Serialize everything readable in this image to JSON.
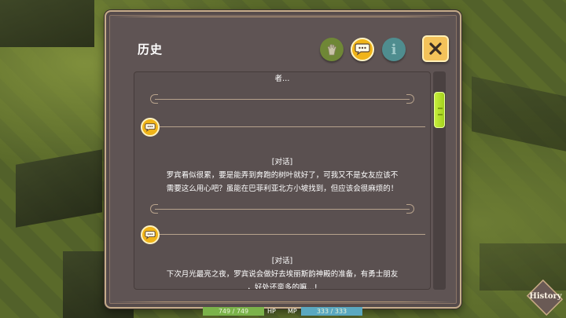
{
  "panel": {
    "title": "历史"
  },
  "header_buttons": {
    "hand_icon": "hand-icon",
    "chat_icon": "speech-bubble-icon",
    "info_label": "i",
    "close_icon": "close-icon"
  },
  "log": {
    "entries": [
      {
        "tag": "",
        "lines": [
          "者…"
        ]
      },
      {
        "tag": "[对话]",
        "lines": [
          "罗宾看似很累，要是能弄到奔跑的树叶就好了，可我又不是女友应该不",
          "需要这么用心吧？虽能在巴菲利亚北方小坡找到，但应该会很麻烦的！"
        ]
      },
      {
        "tag": "[对话]",
        "lines": [
          "下次月光最亮之夜，罗宾说会做好去埃丽斯韵神殿的准备，有勇士朋友",
          "，好处还蛮多的嘛…!"
        ]
      }
    ]
  },
  "hud": {
    "hp_value": "749 / 749",
    "hp_label": "HP",
    "mp_label": "MP",
    "mp_value": "333 / 333"
  },
  "history_button": {
    "label": "History"
  },
  "colors": {
    "panel_bg": "#5f5454",
    "panel_border": "#c6ad8a",
    "accent_yellow": "#f0b419",
    "scroll_thumb": "#b8e02a",
    "hp_bar": "#7bb34a",
    "mp_bar": "#5aa8c0"
  }
}
